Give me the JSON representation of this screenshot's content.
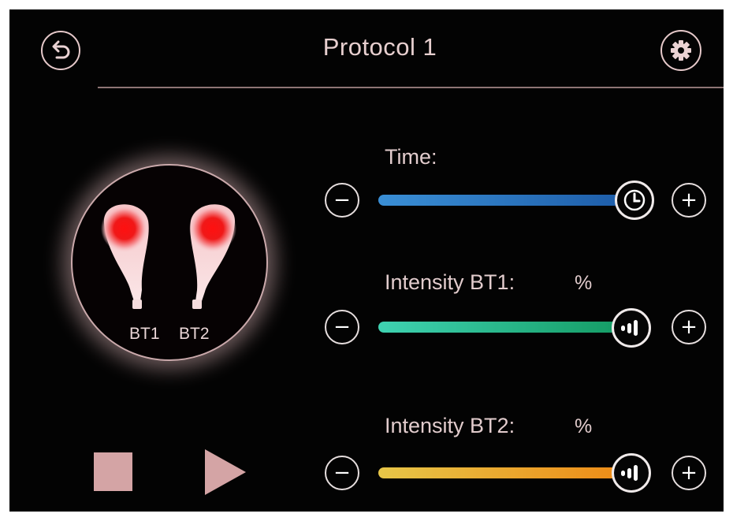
{
  "header": {
    "title": "Protocol 1",
    "back_icon": "back-arrow-icon",
    "settings_icon": "gear-icon"
  },
  "probes": {
    "labels": [
      "BT1",
      "BT2"
    ],
    "glow_color": "#ff1010"
  },
  "time": {
    "label": "Time:",
    "icon": "clock-icon",
    "level": 1.0,
    "gradient": [
      "#3a8fd6",
      "#1d5ca8"
    ]
  },
  "intensity_bt1": {
    "label": "Intensity BT1:",
    "unit": "%",
    "icon": "signal-bars-icon",
    "level": 1.0,
    "gradient": [
      "#3fd3b2",
      "#139a62"
    ]
  },
  "intensity_bt2": {
    "label": "Intensity BT2:",
    "unit": "%",
    "icon": "signal-bars-icon",
    "level": 1.0,
    "gradient": [
      "#e7c648",
      "#ee8a16"
    ]
  },
  "controls": {
    "stop_icon": "stop-icon",
    "play_icon": "play-icon",
    "color": "#d4a4a5"
  },
  "steppers": {
    "minus": "−",
    "plus": "+"
  }
}
